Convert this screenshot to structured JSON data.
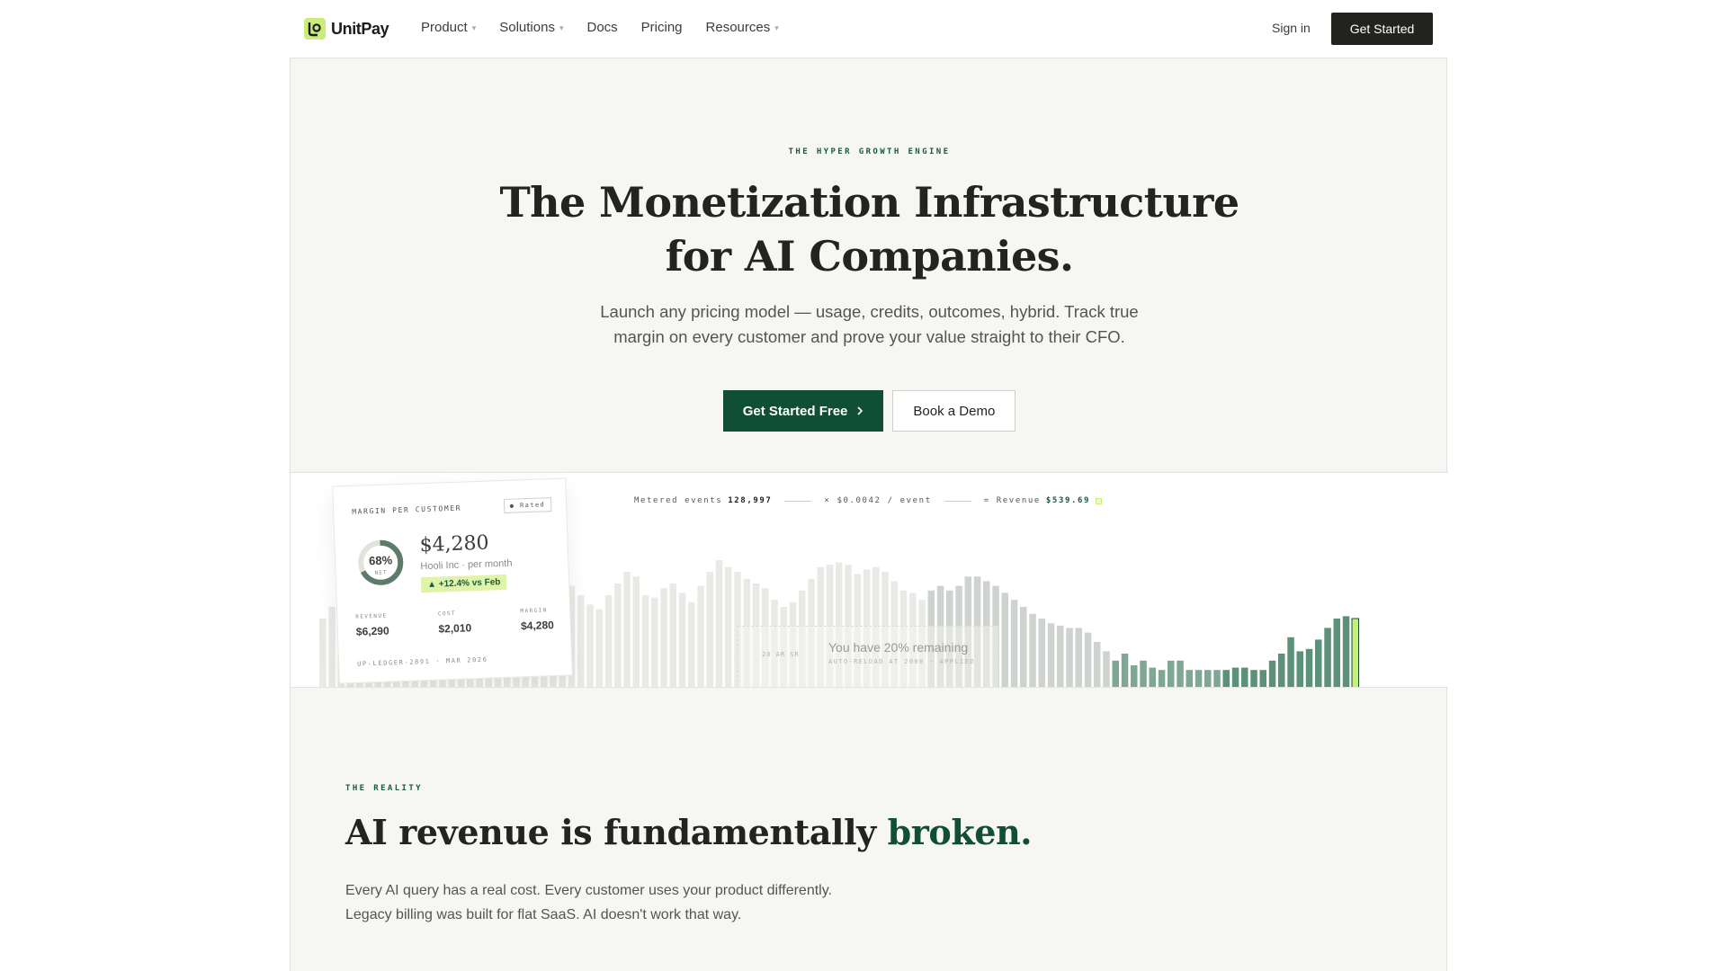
{
  "nav": {
    "brand": "UnitPay",
    "items": [
      {
        "label": "Product",
        "dropdown": true
      },
      {
        "label": "Solutions",
        "dropdown": true
      },
      {
        "label": "Docs",
        "dropdown": false
      },
      {
        "label": "Pricing",
        "dropdown": false
      },
      {
        "label": "Resources",
        "dropdown": true
      }
    ],
    "sign_in": "Sign in",
    "cta": "Get Started"
  },
  "hero": {
    "eyebrow": "The hyper growth engine",
    "title_line1": "The Monetization Infrastructure",
    "title_line2": "for AI Companies.",
    "subtitle_line1": "Launch any pricing model — usage, credits, outcomes, hybrid. Track true",
    "subtitle_line2": "margin on every customer and prove your value straight to their CFO.",
    "primary_cta": "Get Started Free",
    "secondary_cta": "Book a Demo"
  },
  "metrics": {
    "events_label": "Metered events",
    "events_value": "128,997",
    "rate": "× $0.0042 / event",
    "revenue_label": "= Revenue",
    "revenue_value": "$539.69"
  },
  "margin_card": {
    "label": "Margin per customer",
    "badge": "● Rated",
    "donut_pct": "68%",
    "donut_fraction": 0.68,
    "donut_sub": "NET",
    "amount": "$4,280",
    "desc": "Hooli Inc · per month",
    "delta": "▲ +12.4% vs Feb",
    "stats": [
      {
        "label": "Revenue",
        "value": "$6,290"
      },
      {
        "label": "Cost",
        "value": "$2,010"
      },
      {
        "label": "Margin",
        "value": "$4,280"
      }
    ],
    "footer": "UP-LEDGER-2891 · MAR 2026"
  },
  "ghost_card": {
    "text": "You have 20% remaining",
    "left_text": "20  AR  SR",
    "sub": "AUTO-RELOAD AT 2000 · APPLIED"
  },
  "reality": {
    "eyebrow": "The reality",
    "title": "AI revenue is fundamentally",
    "title_accent": "broken.",
    "body_line1": "Every AI query has a real cost. Every customer uses your product differently.",
    "body_line2": "Legacy billing was built for flat SaaS. AI doesn't work that way."
  },
  "colors": {
    "brand_green": "#114e36",
    "accent_lime": "#c9ec7a",
    "dark": "#22221f",
    "band_bar_light": "#e9e9e6",
    "band_bar_mid": "#cfd3cf",
    "band_bar_green": "#7ea894",
    "band_bar_dark": "#5a9178"
  },
  "usage_bars": [
    0.3,
    0.35,
    0.4,
    0.45,
    0.5,
    0.55,
    0.58,
    0.5,
    0.48,
    0.44,
    0.4,
    0.36,
    0.5,
    0.52,
    0.48,
    0.42,
    0.37,
    0.35,
    0.42,
    0.47,
    0.42,
    0.4,
    0.38,
    0.44,
    0.52,
    0.5,
    0.48,
    0.44,
    0.4,
    0.36,
    0.34,
    0.4,
    0.45,
    0.5,
    0.48,
    0.4,
    0.39,
    0.43,
    0.45,
    0.41,
    0.37,
    0.44,
    0.5,
    0.55,
    0.52,
    0.5,
    0.47,
    0.45,
    0.43,
    0.38,
    0.35,
    0.37,
    0.42,
    0.47,
    0.52,
    0.53,
    0.54,
    0.53,
    0.49,
    0.51,
    0.52,
    0.5,
    0.46,
    0.42,
    0.41,
    0.38,
    0.42,
    0.44,
    0.42,
    0.44,
    0.48,
    0.48,
    0.46,
    0.44,
    0.41,
    0.38,
    0.35,
    0.32,
    0.3,
    0.28,
    0.27,
    0.26,
    0.26,
    0.24,
    0.2,
    0.16,
    0.12,
    0.15,
    0.1,
    0.12,
    0.09,
    0.08,
    0.12,
    0.12,
    0.08,
    0.08,
    0.08,
    0.08,
    0.08,
    0.09,
    0.09,
    0.08,
    0.08,
    0.12,
    0.15,
    0.22,
    0.16,
    0.17,
    0.21,
    0.26,
    0.3,
    0.31,
    0.3
  ]
}
